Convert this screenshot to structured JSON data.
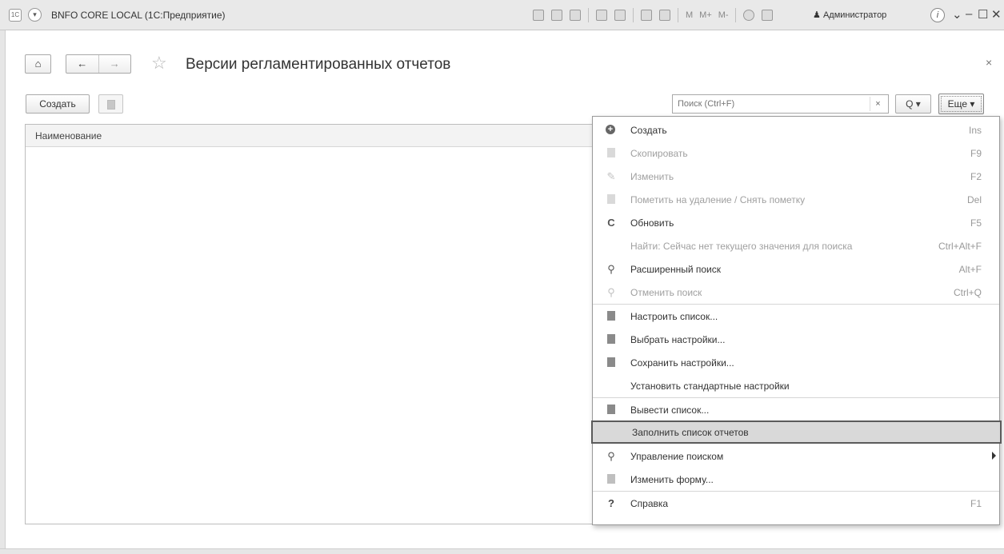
{
  "titlebar": {
    "logo": "1С",
    "title": "BNFO CORE LOCAL  (1С:Предприятие)",
    "m_labels": [
      "M",
      "M+",
      "M-"
    ],
    "user": "Администратор",
    "info": "i"
  },
  "form": {
    "title": "Версии регламентированных отчетов",
    "close": "×"
  },
  "commandbar": {
    "create_label": "Создать",
    "search_placeholder": "Поиск (Ctrl+F)",
    "search_clear": "×",
    "search_btn": "Q ▾",
    "more_label": "Еще ▾"
  },
  "table": {
    "columns": [
      "Наименование"
    ]
  },
  "menu": {
    "items": [
      {
        "label": "Создать",
        "shortcut": "Ins",
        "icon": "plus-circle-icon"
      },
      {
        "label": "Скопировать",
        "shortcut": "F9",
        "icon": "copy-icon"
      },
      {
        "label": "Изменить",
        "shortcut": "F2",
        "icon": "pencil-icon"
      },
      {
        "label": "Пометить на удаление / Снять пометку",
        "shortcut": "Del",
        "icon": "delete-mark-icon"
      },
      {
        "label": "Обновить",
        "shortcut": "F5",
        "icon": "refresh-icon"
      },
      {
        "label": "Найти: Сейчас нет текущего значения для поиска",
        "shortcut": "Ctrl+Alt+F"
      },
      {
        "label": "Расширенный поиск",
        "shortcut": "Alt+F",
        "icon": "advanced-search-icon"
      },
      {
        "label": "Отменить поиск",
        "shortcut": "Ctrl+Q",
        "icon": "cancel-search-icon"
      },
      {
        "label": "Настроить список...",
        "icon": "list-settings-icon"
      },
      {
        "label": "Выбрать настройки...",
        "icon": "load-settings-icon"
      },
      {
        "label": "Сохранить настройки...",
        "icon": "save-settings-icon"
      },
      {
        "label": "Установить стандартные настройки"
      },
      {
        "label": "Вывести список...",
        "icon": "output-list-icon"
      },
      {
        "label": "Заполнить список отчетов"
      },
      {
        "label": "Управление поиском",
        "icon": "search-icon"
      },
      {
        "label": "Изменить форму...",
        "icon": "form-icon"
      },
      {
        "label": "Справка",
        "shortcut": "F1",
        "icon": "help-icon"
      }
    ]
  }
}
